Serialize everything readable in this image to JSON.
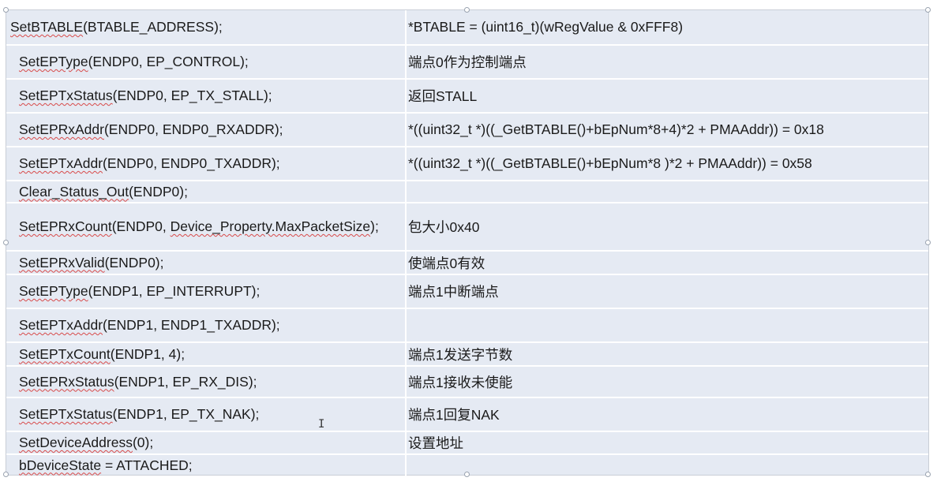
{
  "table": {
    "rows": [
      {
        "left": [
          {
            "t": "SetBTABLE",
            "u": true
          },
          {
            "t": "(BTABLE_ADDRESS);"
          }
        ],
        "right": "*BTABLE = (uint16_t)(wRegValue & 0xFFF8)"
      },
      {
        "left": [
          {
            "t": "SetEPType",
            "u": true
          },
          {
            "t": "(ENDP0, EP_CONTROL);"
          }
        ],
        "right": "端点0作为控制端点"
      },
      {
        "left": [
          {
            "t": "SetEPTxStatus",
            "u": true
          },
          {
            "t": "(ENDP0, EP_TX_STALL);"
          }
        ],
        "right": "返回STALL"
      },
      {
        "left": [
          {
            "t": "SetEPRxAddr",
            "u": true
          },
          {
            "t": "(ENDP0, ENDP0_RXADDR);"
          }
        ],
        "right": "*((uint32_t *)((_GetBTABLE()+bEpNum*8+4)*2 + PMAAddr)) = 0x18"
      },
      {
        "left": [
          {
            "t": "SetEPTxAddr",
            "u": true
          },
          {
            "t": "(ENDP0, ENDP0_TXADDR);"
          }
        ],
        "right": "*((uint32_t *)((_GetBTABLE()+bEpNum*8  )*2 + PMAAddr)) = 0x58"
      },
      {
        "left": [
          {
            "t": "Clear_Status_Out",
            "u": true
          },
          {
            "t": "(ENDP0);"
          }
        ],
        "right": ""
      },
      {
        "left": [
          {
            "t": "SetEPRxCount",
            "u": true
          },
          {
            "t": "(ENDP0, "
          },
          {
            "t": "Device_Property.MaxPacketSize",
            "u": true
          },
          {
            "t": ");"
          }
        ],
        "right": "包大小0x40"
      },
      {
        "left": [
          {
            "t": "SetEPRxValid",
            "u": true
          },
          {
            "t": "(ENDP0);"
          }
        ],
        "right": "使端点0有效"
      },
      {
        "left": [
          {
            "t": "SetEPType",
            "u": true
          },
          {
            "t": "(ENDP1, EP_INTERRUPT);"
          }
        ],
        "right": "端点1中断端点"
      },
      {
        "left": [
          {
            "t": "SetEPTxAddr",
            "u": true
          },
          {
            "t": "(ENDP1, ENDP1_TXADDR);"
          }
        ],
        "right": ""
      },
      {
        "left": [
          {
            "t": "SetEPTxCount",
            "u": true
          },
          {
            "t": "(ENDP1, 4);"
          }
        ],
        "right": "端点1发送字节数"
      },
      {
        "left": [
          {
            "t": "SetEPRxStatus",
            "u": true
          },
          {
            "t": "(ENDP1, EP_RX_DIS);"
          }
        ],
        "right": "端点1接收未使能"
      },
      {
        "left": [
          {
            "t": "SetEPTxStatus",
            "u": true
          },
          {
            "t": "(ENDP1, EP_TX_NAK);"
          }
        ],
        "right": "端点1回复NAK"
      },
      {
        "left": [
          {
            "t": "SetDeviceAddress",
            "u": true
          },
          {
            "t": "(0);"
          }
        ],
        "right": "设置地址"
      },
      {
        "left": [
          {
            "t": "bDeviceState",
            "u": true
          },
          {
            "t": " = ATTACHED;"
          }
        ],
        "right": ""
      }
    ]
  },
  "colors": {
    "cell_bg": "#e5eaf3",
    "grid": "#ffffff",
    "squiggle": "#d84a4a"
  }
}
